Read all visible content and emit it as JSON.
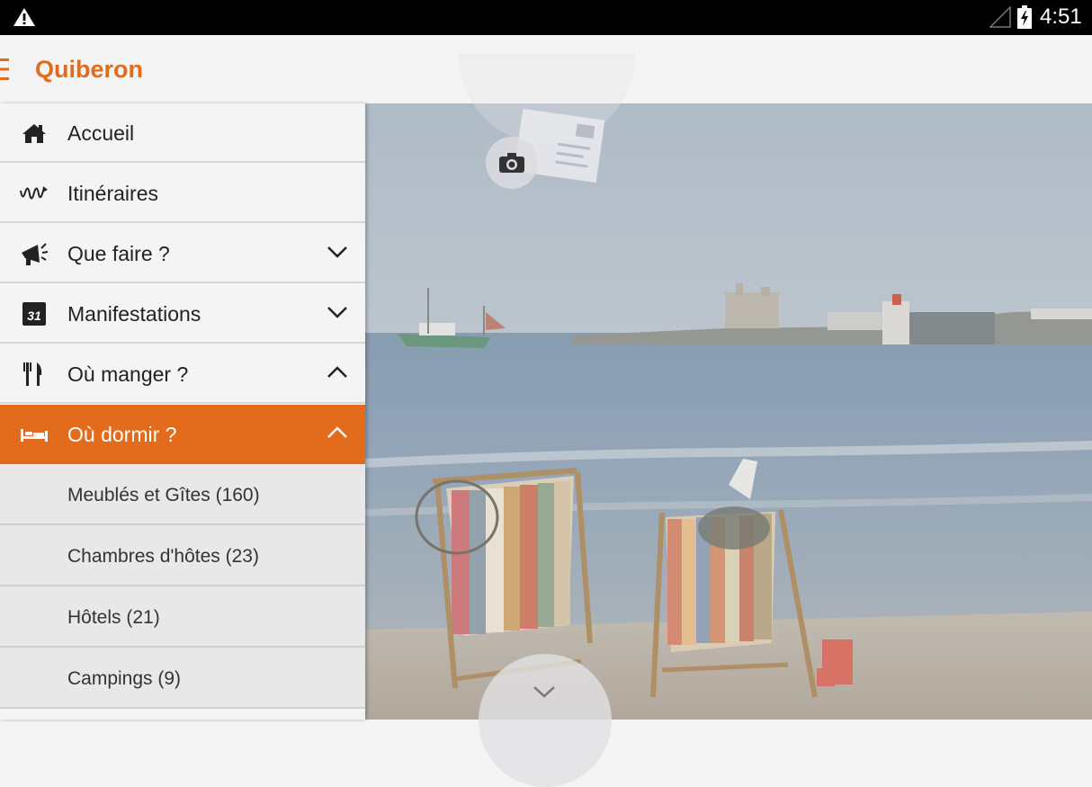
{
  "status_bar": {
    "time": "4:51",
    "icons": [
      "warning-icon",
      "signal-icon",
      "battery-charging-icon"
    ]
  },
  "action_bar": {
    "title": "Quiberon",
    "menu_icon": "hamburger-icon"
  },
  "drawer": {
    "items": [
      {
        "label": "Accueil",
        "icon": "home-icon",
        "expandable": false
      },
      {
        "label": "Itinéraires",
        "icon": "route-icon",
        "expandable": false
      },
      {
        "label": "Que faire ?",
        "icon": "megaphone-icon",
        "expandable": true,
        "state": "collapsed"
      },
      {
        "label": "Manifestations",
        "icon": "calendar-icon",
        "icon_text": "31",
        "expandable": true,
        "state": "collapsed"
      },
      {
        "label": "Où manger ?",
        "icon": "fork-knife-icon",
        "expandable": true,
        "state": "expanded"
      },
      {
        "label": "Où dormir ?",
        "icon": "bed-icon",
        "expandable": true,
        "state": "expanded",
        "active": true
      }
    ],
    "subitems": [
      {
        "label": "Meublés et Gîtes (160)"
      },
      {
        "label": "Chambres d'hôtes (23)"
      },
      {
        "label": "Hôtels (21)"
      },
      {
        "label": "Campings (9)"
      }
    ]
  },
  "main": {
    "camera_button_icon": "camera-icon",
    "postcard_icon": "postcard-icon",
    "scroll_down_icon": "chevron-down-icon"
  },
  "colors": {
    "accent": "#e36b1c",
    "status_bar": "#000000",
    "drawer_bg": "#f4f4f4",
    "subitem_bg": "#e8e8e8"
  }
}
